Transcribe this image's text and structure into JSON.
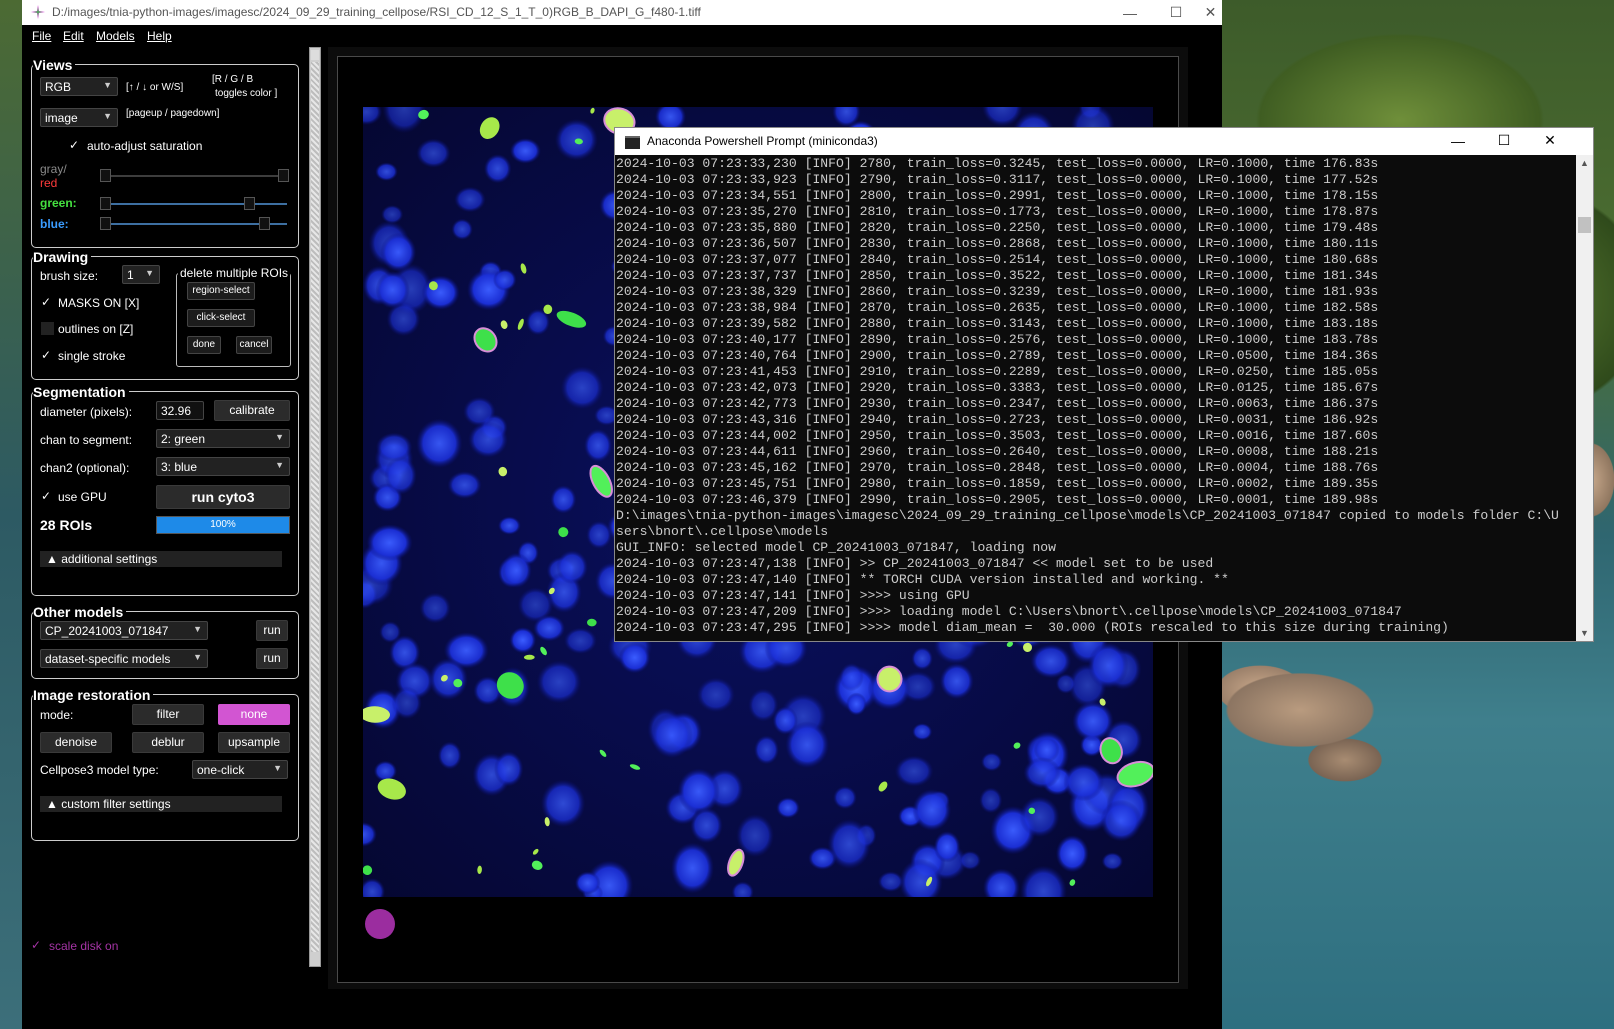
{
  "cellpose_window": {
    "title": "D:/images/tnia-python-images/imagesc/2024_09_29_training_cellpose/RSI_CD_12_S_1_T_0)RGB_B_DAPI_G_f480-1.tiff",
    "controls": {
      "minimize": "—",
      "maximize": "☐",
      "close": "✕"
    },
    "menu": [
      "File",
      "Edit",
      "Models",
      "Help"
    ]
  },
  "views": {
    "title": "Views",
    "color_mode": "RGB",
    "color_hint": "[↑ / ↓ or W/S]",
    "toggle_hint_line1": "[R / G / B",
    "toggle_hint_line2": "toggles color ]",
    "display": "image",
    "page_hint": "[pageup / pagedown]",
    "auto_adjust": "auto-adjust saturation",
    "gray_label": "gray/",
    "red_label": "red",
    "green_label": "green:",
    "blue_label": "blue:",
    "colors": {
      "red": "#ff3b3b",
      "green": "#45e040",
      "blue": "#3a9cff"
    }
  },
  "drawing": {
    "title": "Drawing",
    "brush_label": "brush size:",
    "brush_value": "1",
    "masks_on": "MASKS ON [X]",
    "outlines_on": "outlines on [Z]",
    "single_stroke": "single stroke",
    "delete_group": "delete multiple ROIs",
    "region_select": "region-select",
    "click_select": "click-select",
    "done": "done",
    "cancel": "cancel"
  },
  "segmentation": {
    "title": "Segmentation",
    "diameter_label": "diameter (pixels):",
    "diameter_value": "32.96",
    "calibrate": "calibrate",
    "chan_label": "chan to segment:",
    "chan_value": "2: green",
    "chan2_label": "chan2 (optional):",
    "chan2_value": "3: blue",
    "use_gpu": "use GPU",
    "run_button": "run cyto3",
    "roi_count": "28 ROIs",
    "progress_text": "100%",
    "progress_fraction": 1.0,
    "additional": "▲ additional settings"
  },
  "other_models": {
    "title": "Other models",
    "model_value": "CP_20241003_071847",
    "dataset_value": "dataset-specific models",
    "run": "run"
  },
  "restoration": {
    "title": "Image restoration",
    "mode_label": "mode:",
    "filter": "filter",
    "none": "none",
    "denoise": "denoise",
    "deblur": "deblur",
    "upsample": "upsample",
    "model_type_label": "Cellpose3 model type:",
    "model_type_value": "one-click",
    "custom": "▲ custom filter settings",
    "accent": "#d255d2"
  },
  "scale_disk": "scale disk on",
  "console": {
    "title": "Anaconda Powershell Prompt (miniconda3)",
    "controls": {
      "minimize": "—",
      "maximize": "☐",
      "close": "✕"
    },
    "lines": [
      "2024-10-03 07:23:33,230 [INFO] 2780, train_loss=0.3245, test_loss=0.0000, LR=0.1000, time 176.83s",
      "2024-10-03 07:23:33,923 [INFO] 2790, train_loss=0.3117, test_loss=0.0000, LR=0.1000, time 177.52s",
      "2024-10-03 07:23:34,551 [INFO] 2800, train_loss=0.2991, test_loss=0.0000, LR=0.1000, time 178.15s",
      "2024-10-03 07:23:35,270 [INFO] 2810, train_loss=0.1773, test_loss=0.0000, LR=0.1000, time 178.87s",
      "2024-10-03 07:23:35,880 [INFO] 2820, train_loss=0.2250, test_loss=0.0000, LR=0.1000, time 179.48s",
      "2024-10-03 07:23:36,507 [INFO] 2830, train_loss=0.2868, test_loss=0.0000, LR=0.1000, time 180.11s",
      "2024-10-03 07:23:37,077 [INFO] 2840, train_loss=0.2514, test_loss=0.0000, LR=0.1000, time 180.68s",
      "2024-10-03 07:23:37,737 [INFO] 2850, train_loss=0.3522, test_loss=0.0000, LR=0.1000, time 181.34s",
      "2024-10-03 07:23:38,329 [INFO] 2860, train_loss=0.3239, test_loss=0.0000, LR=0.1000, time 181.93s",
      "2024-10-03 07:23:38,984 [INFO] 2870, train_loss=0.2635, test_loss=0.0000, LR=0.1000, time 182.58s",
      "2024-10-03 07:23:39,582 [INFO] 2880, train_loss=0.3143, test_loss=0.0000, LR=0.1000, time 183.18s",
      "2024-10-03 07:23:40,177 [INFO] 2890, train_loss=0.2576, test_loss=0.0000, LR=0.1000, time 183.78s",
      "2024-10-03 07:23:40,764 [INFO] 2900, train_loss=0.2789, test_loss=0.0000, LR=0.0500, time 184.36s",
      "2024-10-03 07:23:41,453 [INFO] 2910, train_loss=0.2289, test_loss=0.0000, LR=0.0250, time 185.05s",
      "2024-10-03 07:23:42,073 [INFO] 2920, train_loss=0.3383, test_loss=0.0000, LR=0.0125, time 185.67s",
      "2024-10-03 07:23:42,773 [INFO] 2930, train_loss=0.2347, test_loss=0.0000, LR=0.0063, time 186.37s",
      "2024-10-03 07:23:43,316 [INFO] 2940, train_loss=0.2723, test_loss=0.0000, LR=0.0031, time 186.92s",
      "2024-10-03 07:23:44,002 [INFO] 2950, train_loss=0.3503, test_loss=0.0000, LR=0.0016, time 187.60s",
      "2024-10-03 07:23:44,611 [INFO] 2960, train_loss=0.2640, test_loss=0.0000, LR=0.0008, time 188.21s",
      "2024-10-03 07:23:45,162 [INFO] 2970, train_loss=0.2848, test_loss=0.0000, LR=0.0004, time 188.76s",
      "2024-10-03 07:23:45,751 [INFO] 2980, train_loss=0.1859, test_loss=0.0000, LR=0.0002, time 189.35s",
      "2024-10-03 07:23:46,379 [INFO] 2990, train_loss=0.2905, test_loss=0.0000, LR=0.0001, time 189.98s",
      "D:\\images\\tnia-python-images\\imagesc\\2024_09_29_training_cellpose\\models\\CP_20241003_071847 copied to models folder C:\\U",
      "sers\\bnort\\.cellpose\\models",
      "GUI_INFO: selected model CP_20241003_071847, loading now",
      "2024-10-03 07:23:47,138 [INFO] >> CP_20241003_071847 << model set to be used",
      "2024-10-03 07:23:47,140 [INFO] ** TORCH CUDA version installed and working. **",
      "2024-10-03 07:23:47,141 [INFO] >>>> using GPU",
      "2024-10-03 07:23:47,209 [INFO] >>>> loading model C:\\Users\\bnort\\.cellpose\\models\\CP_20241003_071847",
      "2024-10-03 07:23:47,295 [INFO] >>>> model diam_mean =  30.000 (ROIs rescaled to this size during training)"
    ]
  }
}
